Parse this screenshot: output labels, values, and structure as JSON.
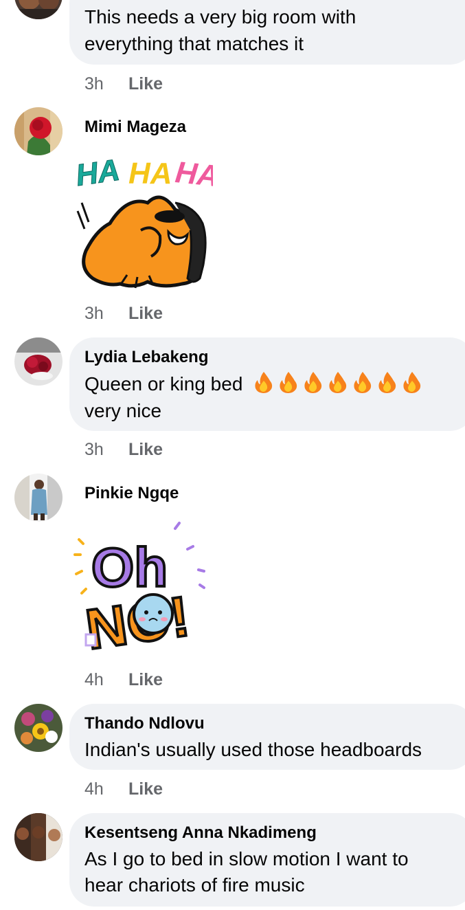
{
  "comments": [
    {
      "author": "",
      "text_lines": [
        "This needs a very big room with",
        "everything that matches it"
      ],
      "time": "3h",
      "like_label": "Like"
    },
    {
      "author": "Mimi Mageza",
      "sticker": "haha-laughing-dog-sticker",
      "sticker_text": [
        "HA",
        "HA",
        "HA"
      ],
      "time": "3h",
      "like_label": "Like"
    },
    {
      "author": "Lydia Lebakeng",
      "text_lines": [
        "Queen or king bed",
        "very nice"
      ],
      "emoji": "fire",
      "emoji_count": 7,
      "time": "3h",
      "like_label": "Like"
    },
    {
      "author": "Pinkie Ngqe",
      "sticker": "oh-no-sticker",
      "sticker_text": [
        "Oh",
        "NO!"
      ],
      "time": "4h",
      "like_label": "Like"
    },
    {
      "author": "Thando Ndlovu",
      "text_lines": [
        "Indian's usually used those headboards"
      ],
      "time": "4h",
      "like_label": "Like"
    },
    {
      "author": "Kesentseng Anna Nkadimeng",
      "text_lines": [
        "As I go to bed in slow motion I want to",
        "hear chariots of fire music"
      ]
    }
  ],
  "colors": {
    "bubble": "#f0f2f5",
    "meta_text": "#65676b",
    "name_text": "#050505"
  }
}
